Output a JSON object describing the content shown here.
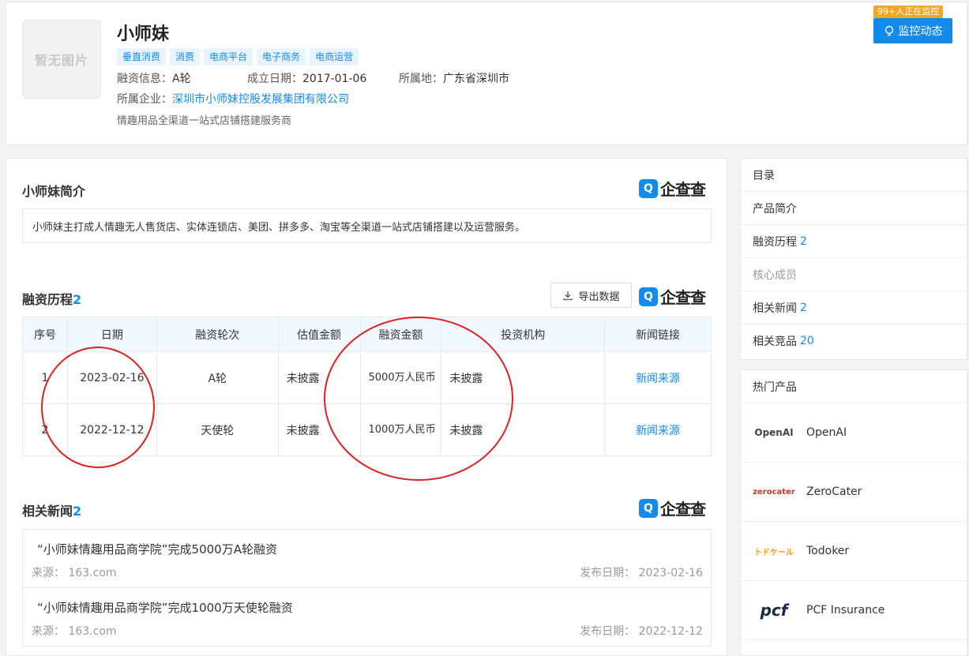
{
  "company": {
    "logo_placeholder": "暂无图片",
    "name": "小师妹",
    "tags": [
      "垂直消费",
      "消费",
      "电商平台",
      "电子商务",
      "电商运营"
    ],
    "funding_label": "融资信息：",
    "funding_value": "A轮",
    "founded_label": "成立日期：",
    "founded_value": "2017-01-06",
    "location_label": "所属地：",
    "location_value": "广东省深圳市",
    "enterprise_label": "所属企业：",
    "enterprise_value": "深圳市小师妹控股发展集团有限公司",
    "description": "情趣用品全渠道一站式店铺搭建服务商"
  },
  "monitor": {
    "badge": "99+人正在监控",
    "button_label": "监控动态"
  },
  "brand": {
    "mark": "Q",
    "text": "企查查"
  },
  "intro": {
    "title": "小师妹简介",
    "text": "小师妹主打成人情趣无人售货店、实体连锁店、美团、拼多多、淘宝等全渠道一站式店铺搭建以及运营服务。"
  },
  "financing": {
    "title": "融资历程",
    "count": "2",
    "export_label": "导出数据",
    "columns": [
      "序号",
      "日期",
      "融资轮次",
      "估值金额",
      "融资金额",
      "投资机构",
      "新闻链接"
    ],
    "rows": [
      {
        "index": "1",
        "date": "2023-02-16",
        "round": "A轮",
        "valuation": "未披露",
        "amount": "5000万人民币",
        "investor": "未披露",
        "news": "新闻来源"
      },
      {
        "index": "2",
        "date": "2022-12-12",
        "round": "天使轮",
        "valuation": "未披露",
        "amount": "1000万人民币",
        "investor": "未披露",
        "news": "新闻来源"
      }
    ]
  },
  "news": {
    "title": "相关新闻",
    "count": "2",
    "items": [
      {
        "title": "“小师妹情趣用品商学院”完成5000万A轮融资",
        "source_label": "来源：",
        "source": "163.com",
        "date_label": "发布日期：",
        "date": "2023-02-16"
      },
      {
        "title": "“小师妹情趣用品商学院”完成1000万天使轮融资",
        "source_label": "来源：",
        "source": "163.com",
        "date_label": "发布日期：",
        "date": "2022-12-12"
      }
    ]
  },
  "toc": {
    "title": "目录",
    "items": [
      {
        "label": "产品简介",
        "count": ""
      },
      {
        "label": "融资历程",
        "count": "2"
      },
      {
        "label": "核心成员",
        "count": ""
      },
      {
        "label": "相关新闻",
        "count": "2"
      },
      {
        "label": "相关竞品",
        "count": "20"
      }
    ]
  },
  "hot": {
    "title": "热门产品",
    "items": [
      {
        "logo": "OpenAI",
        "name": "OpenAI"
      },
      {
        "logo": "zerocater",
        "name": "ZeroCater"
      },
      {
        "logo": "トドケール",
        "name": "Todoker"
      },
      {
        "logo": "pcf",
        "name": "PCF Insurance"
      }
    ]
  },
  "colors": {
    "accent": "#128bed",
    "badge": "#f5a623",
    "annotation": "#e02020"
  }
}
